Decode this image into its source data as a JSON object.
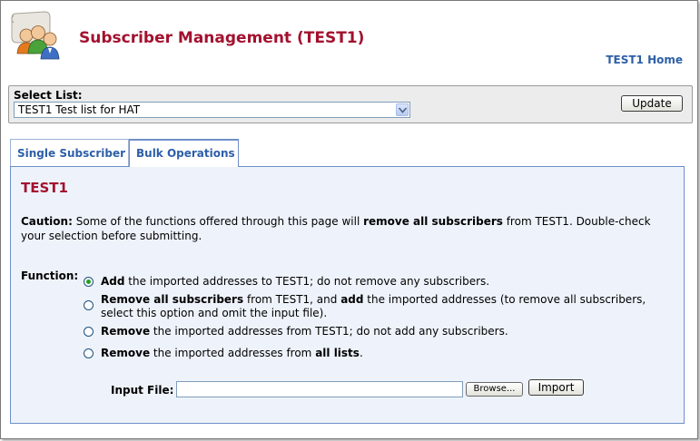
{
  "header": {
    "title": "Subscriber Management (TEST1)",
    "home_link": "TEST1 Home"
  },
  "list_selector": {
    "label": "Select List:",
    "selected_value": "TEST1 Test list for HAT",
    "update_button": "Update"
  },
  "tabs": [
    {
      "label": "Single Subscriber",
      "active": false
    },
    {
      "label": "Bulk Operations",
      "active": true
    }
  ],
  "content": {
    "list_name": "TEST1",
    "caution": {
      "prefix": "Caution:",
      "part1": " Some of the functions offered through this page will ",
      "bold": "remove all subscribers",
      "part2": " from TEST1. Double-check your selection before submitting."
    },
    "function_label": "Function:",
    "options": [
      {
        "checked": true,
        "bold1": "Add",
        "text1": " the imported addresses to TEST1; do not remove any subscribers.",
        "bold2": "",
        "text2": ""
      },
      {
        "checked": false,
        "bold1": "Remove all subscribers",
        "text1": " from TEST1, and ",
        "bold2": "add",
        "text2": " the imported addresses (to remove all subscribers, select this option and omit the input file)."
      },
      {
        "checked": false,
        "bold1": "Remove",
        "text1": " the imported addresses from TEST1; do not add any subscribers.",
        "bold2": "",
        "text2": ""
      },
      {
        "checked": false,
        "bold1": "Remove",
        "text1": " the imported addresses from ",
        "bold2": "all lists",
        "text2": "."
      }
    ],
    "input_file_label": "Input File:",
    "input_file_value": "",
    "browse_button": "Browse...",
    "import_button": "Import"
  },
  "colors": {
    "title_red": "#a3112f",
    "link_blue": "#2d5fa8",
    "panel_bg": "#eef3fb",
    "radio_checked": "#21a121"
  },
  "icons": {
    "header": "subscribers-group-icon",
    "select_arrow": "chevron-down-icon"
  }
}
